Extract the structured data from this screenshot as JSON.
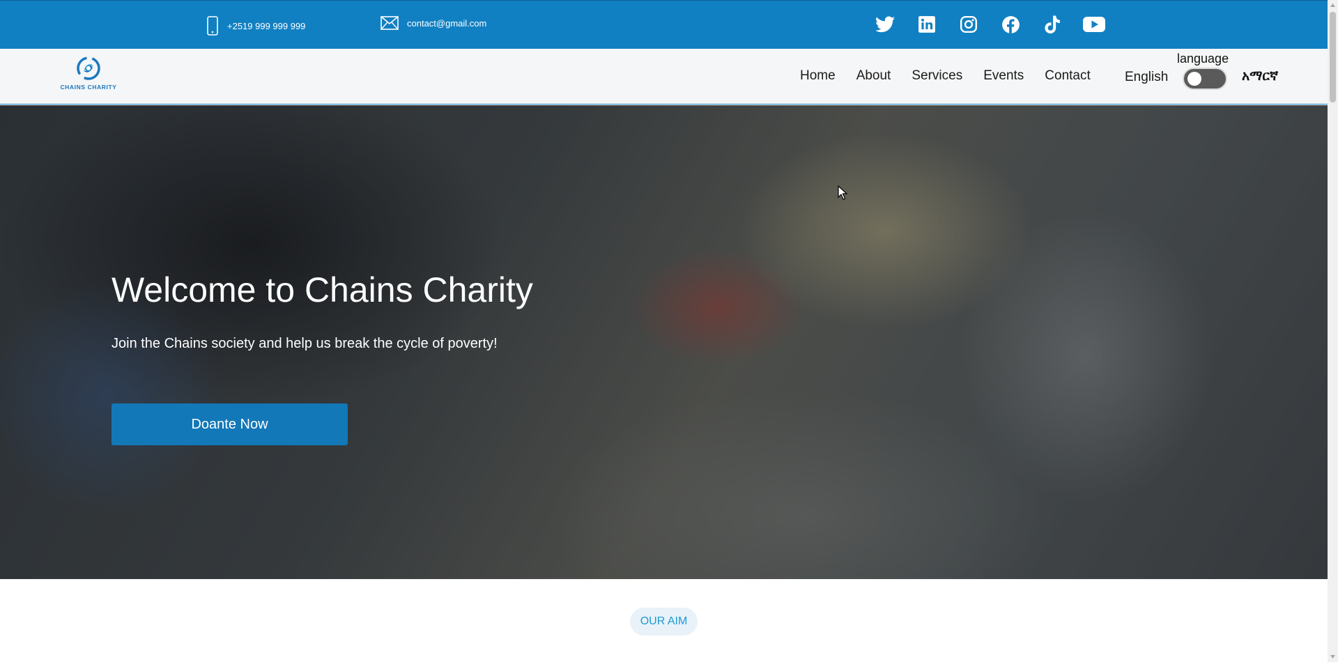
{
  "topbar": {
    "phone": "+2519 999 999 999",
    "email": "contact@gmail.com",
    "socials": [
      "twitter-icon",
      "linkedin-icon",
      "instagram-icon",
      "facebook-icon",
      "tiktok-icon",
      "youtube-icon"
    ]
  },
  "brand": {
    "name": "CHAINS CHARITY",
    "color": "#1180c2"
  },
  "nav": {
    "items": [
      "Home",
      "About",
      "Services",
      "Events",
      "Contact"
    ]
  },
  "language": {
    "caption": "language",
    "current": "English",
    "alternate": "አማርኛ",
    "toggle_on": false
  },
  "hero": {
    "title": "Welcome to Chains Charity",
    "subtitle": "Join the Chains society and help us break the cycle of poverty!",
    "cta": "Doante Now"
  },
  "section": {
    "badge": "OUR AIM"
  }
}
